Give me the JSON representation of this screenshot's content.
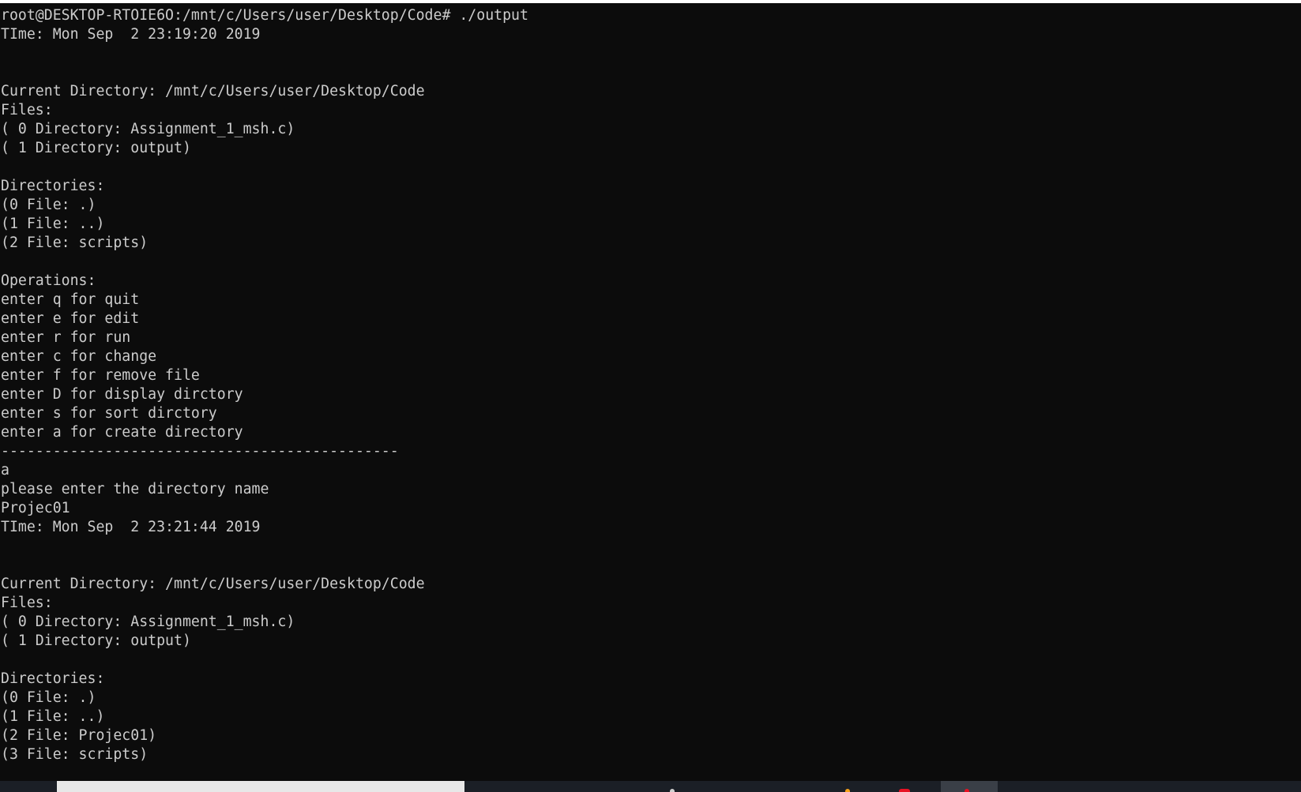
{
  "terminal": {
    "lines": [
      "root@DESKTOP-RTOIE6O:/mnt/c/Users/user/Desktop/Code# ./output",
      "TIme: Mon Sep  2 23:19:20 2019",
      "",
      "",
      "Current Directory: /mnt/c/Users/user/Desktop/Code",
      "Files:",
      "( 0 Directory: Assignment_1_msh.c)",
      "( 1 Directory: output)",
      "",
      "Directories:",
      "(0 File: .)",
      "(1 File: ..)",
      "(2 File: scripts)",
      "",
      "Operations:",
      "enter q for quit",
      "enter e for edit",
      "enter r for run",
      "enter c for change",
      "enter f for remove file",
      "enter D for display dirctory",
      "enter s for sort dirctory",
      "enter a for create directory",
      "----------------------------------------------",
      "a",
      "please enter the directory name",
      "Projec01",
      "TIme: Mon Sep  2 23:21:44 2019",
      "",
      "",
      "Current Directory: /mnt/c/Users/user/Desktop/Code",
      "Files:",
      "( 0 Directory: Assignment_1_msh.c)",
      "( 1 Directory: output)",
      "",
      "Directories:",
      "(0 File: .)",
      "(1 File: ..)",
      "(2 File: Projec01)",
      "(3 File: scripts)"
    ]
  },
  "colors": {
    "background": "#0c0c0c",
    "text": "#cccccc",
    "taskbar": "#1b1f26",
    "taskbar_search": "#e8e8e8",
    "taskbar_active_app": "#3a3f47",
    "taskbar_accent_red": "#e81123",
    "taskbar_accent_orange": "#f7a21b"
  }
}
